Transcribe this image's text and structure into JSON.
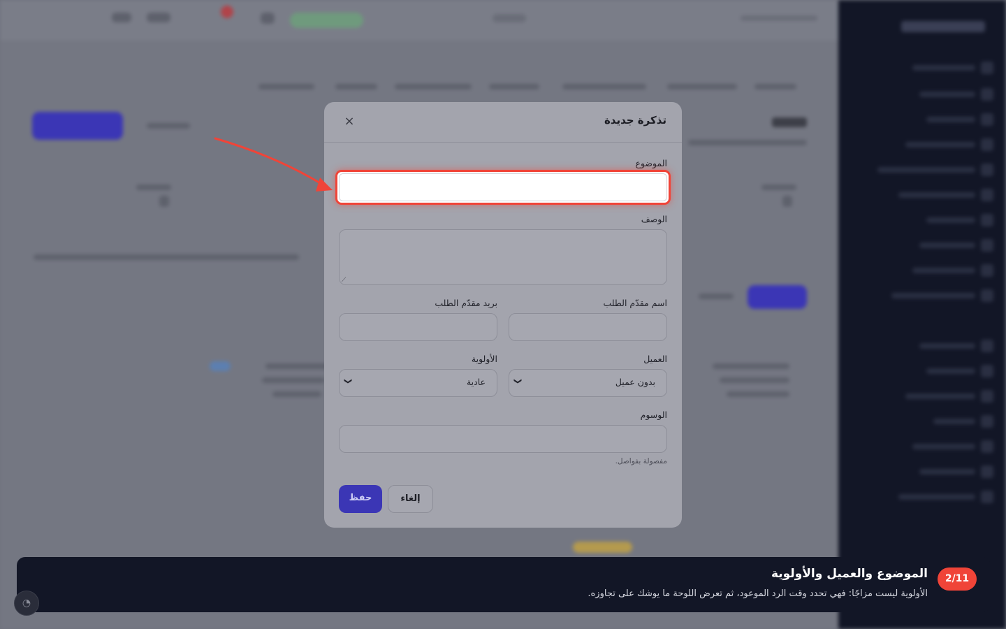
{
  "modal": {
    "title": "تذكرة جديدة",
    "close_icon": "×",
    "subject": {
      "label": "الموضوع",
      "value": ""
    },
    "description": {
      "label": "الوصف",
      "value": ""
    },
    "requester_name": {
      "label": "اسم مقدّم الطلب",
      "value": ""
    },
    "requester_email": {
      "label": "بريد مقدّم الطلب",
      "value": ""
    },
    "customer": {
      "label": "العميل",
      "value": "بدون عميل"
    },
    "priority": {
      "label": "الأولوية",
      "value": "عادية"
    },
    "tags": {
      "label": "الوسوم",
      "value": "",
      "hint": "مفصولة بفواصل."
    },
    "save_label": "حفظ",
    "cancel_label": "إلغاء"
  },
  "tour": {
    "step": "2/11",
    "title": "الموضوع والعميل والأولوية",
    "text": "الأولوية ليست مزاجًا: فهي تحدد وقت الرد الموعود، ثم تعرض اللوحة ما يوشك على تجاوزه."
  },
  "colors": {
    "accent": "#3b36b5",
    "highlight": "#f04438",
    "sidebar": "#121626"
  },
  "icons": {
    "close": "close-icon",
    "chevron": "chevron-down-icon",
    "arrow": "pointer-arrow-icon"
  }
}
